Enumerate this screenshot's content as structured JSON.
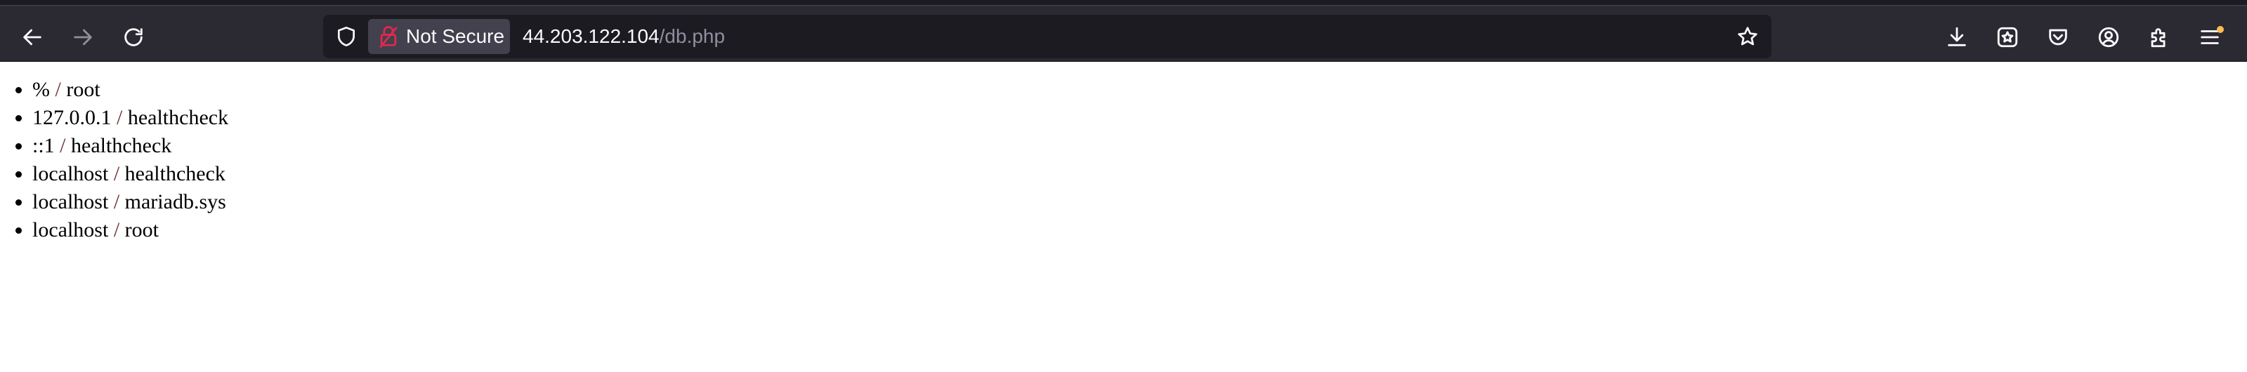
{
  "browser": {
    "security_label": "Not Secure",
    "url_host": "44.203.122.104",
    "url_path": "/db.php",
    "icons": {
      "back": "back-arrow-icon",
      "forward": "forward-arrow-icon",
      "reload": "reload-icon",
      "tracking": "shield-icon",
      "insecure": "insecure-lock-icon",
      "bookmark": "star-icon",
      "downloads": "download-icon",
      "bookmarks_menu": "bookmarks-star-icon",
      "pocket": "pocket-icon",
      "account": "account-icon",
      "extensions": "extensions-icon",
      "menu": "hamburger-menu-icon"
    },
    "colors": {
      "toolbar": "#2b2a33",
      "urlbar": "#1c1b22",
      "insecure_lock": "#e22850",
      "menu_badge": "#ffbd4f"
    }
  },
  "page": {
    "items": [
      {
        "host": "%",
        "user": "root"
      },
      {
        "host": "127.0.0.1",
        "user": "healthcheck"
      },
      {
        "host": "::1",
        "user": "healthcheck"
      },
      {
        "host": "localhost",
        "user": "healthcheck"
      },
      {
        "host": "localhost",
        "user": "mariadb.sys"
      },
      {
        "host": "localhost",
        "user": "root"
      }
    ],
    "separator": " / "
  }
}
